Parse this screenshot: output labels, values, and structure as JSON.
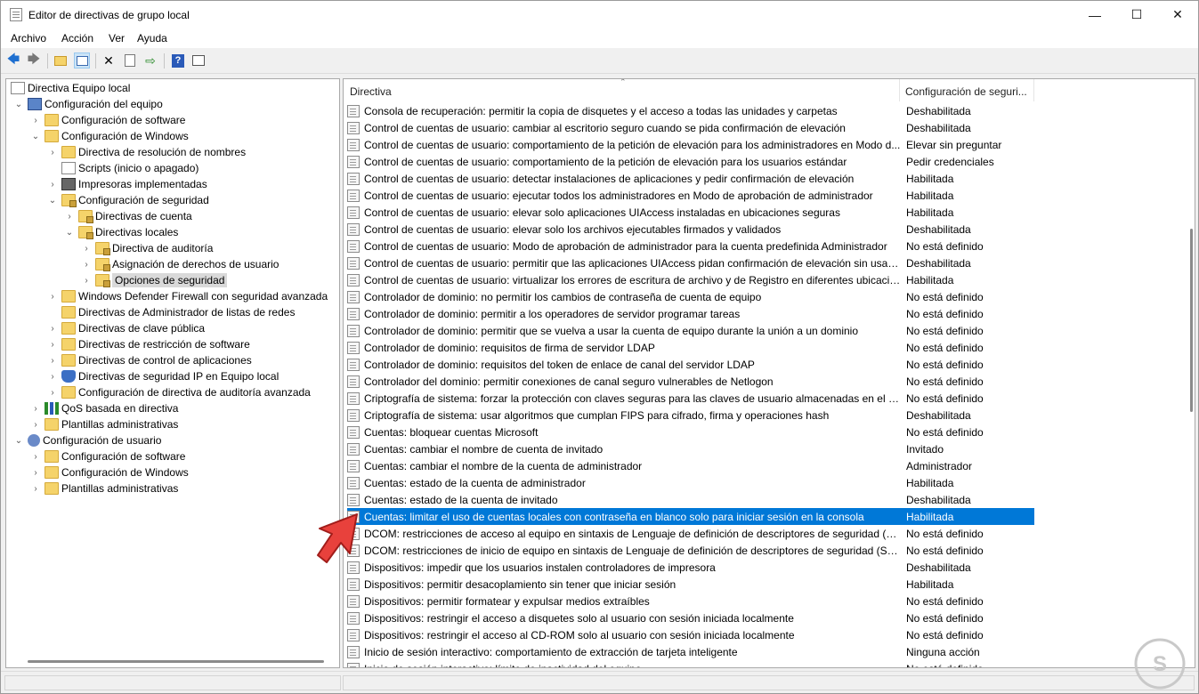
{
  "window": {
    "title": "Editor de directivas de grupo local",
    "controls": {
      "minimize": "—",
      "maximize": "☐",
      "close": "✕"
    }
  },
  "menu": [
    "Archivo",
    "Acción",
    "Ver",
    "Ayuda"
  ],
  "tree": [
    {
      "label": "Directiva Equipo local",
      "icon": "policy-doc-icon",
      "chev": ""
    },
    {
      "label": "Configuración del equipo",
      "icon": "computer-icon",
      "chev": "⌄"
    },
    {
      "label": "Configuración de software",
      "icon": "folder-icon",
      "chev": "›"
    },
    {
      "label": "Configuración de Windows",
      "icon": "folder-icon",
      "chev": "⌄"
    },
    {
      "label": "Directiva de resolución de nombres",
      "icon": "folder-icon",
      "chev": "›"
    },
    {
      "label": "Scripts (inicio o apagado)",
      "icon": "script-icon",
      "chev": ""
    },
    {
      "label": "Impresoras implementadas",
      "icon": "printer-icon",
      "chev": "›"
    },
    {
      "label": "Configuración de seguridad",
      "icon": "security-icon",
      "chev": "⌄"
    },
    {
      "label": "Directivas de cuenta",
      "icon": "folder-lock-icon",
      "chev": "›"
    },
    {
      "label": "Directivas locales",
      "icon": "folder-lock-icon",
      "chev": "⌄"
    },
    {
      "label": "Directiva de auditoría",
      "icon": "folder-lock-icon",
      "chev": "›"
    },
    {
      "label": "Asignación de derechos de usuario",
      "icon": "folder-lock-icon",
      "chev": "›"
    },
    {
      "label": "Opciones de seguridad",
      "icon": "folder-lock-icon",
      "chev": "›",
      "selected": true
    },
    {
      "label": "Windows Defender Firewall con seguridad avanzada",
      "icon": "folder-icon",
      "chev": "›"
    },
    {
      "label": "Directivas de Administrador de listas de redes",
      "icon": "folder-icon",
      "chev": ""
    },
    {
      "label": "Directivas de clave pública",
      "icon": "folder-icon",
      "chev": "›"
    },
    {
      "label": "Directivas de restricción de software",
      "icon": "folder-icon",
      "chev": "›"
    },
    {
      "label": "Directivas de control de aplicaciones",
      "icon": "folder-icon",
      "chev": "›"
    },
    {
      "label": "Directivas de seguridad IP en Equipo local",
      "icon": "ip-security-icon",
      "chev": "›"
    },
    {
      "label": "Configuración de directiva de auditoría avanzada",
      "icon": "folder-icon",
      "chev": "›"
    },
    {
      "label": "QoS basada en directiva",
      "icon": "qos-chart-icon",
      "chev": "›"
    },
    {
      "label": "Plantillas administrativas",
      "icon": "folder-icon",
      "chev": "›"
    },
    {
      "label": "Configuración de usuario",
      "icon": "user-icon",
      "chev": "⌄"
    },
    {
      "label": "Configuración de software",
      "icon": "folder-icon",
      "chev": "›"
    },
    {
      "label": "Configuración de Windows",
      "icon": "folder-icon",
      "chev": "›"
    },
    {
      "label": "Plantillas administrativas",
      "icon": "folder-icon",
      "chev": "›"
    }
  ],
  "columns": {
    "name": "Directiva",
    "value": "Configuración de seguri..."
  },
  "policies": [
    {
      "name": "Consola de recuperación: permitir la copia de disquetes y el acceso a todas las unidades y carpetas",
      "value": "Deshabilitada"
    },
    {
      "name": "Control de cuentas de usuario: cambiar al escritorio seguro cuando se pida confirmación de elevación",
      "value": "Deshabilitada"
    },
    {
      "name": "Control de cuentas de usuario: comportamiento de la petición de elevación para los administradores en Modo d...",
      "value": "Elevar sin preguntar"
    },
    {
      "name": "Control de cuentas de usuario: comportamiento de la petición de elevación para los usuarios estándar",
      "value": "Pedir credenciales"
    },
    {
      "name": "Control de cuentas de usuario: detectar instalaciones de aplicaciones y pedir confirmación de elevación",
      "value": "Habilitada"
    },
    {
      "name": "Control de cuentas de usuario: ejecutar todos los administradores en Modo de aprobación de administrador",
      "value": "Habilitada"
    },
    {
      "name": "Control de cuentas de usuario: elevar solo aplicaciones UIAccess instaladas en ubicaciones seguras",
      "value": "Habilitada"
    },
    {
      "name": "Control de cuentas de usuario: elevar solo los archivos ejecutables firmados y validados",
      "value": "Deshabilitada"
    },
    {
      "name": "Control de cuentas de usuario: Modo de aprobación de administrador para la cuenta predefinida Administrador",
      "value": "No está definido"
    },
    {
      "name": "Control de cuentas de usuario: permitir que las aplicaciones UIAccess pidan confirmación de elevación sin usar ...",
      "value": "Deshabilitada"
    },
    {
      "name": "Control de cuentas de usuario: virtualizar los errores de escritura de archivo y de Registro en diferentes ubicacion...",
      "value": "Habilitada"
    },
    {
      "name": "Controlador de dominio: no permitir los cambios de contraseña de cuenta de equipo",
      "value": "No está definido"
    },
    {
      "name": "Controlador de dominio: permitir a los operadores de servidor programar tareas",
      "value": "No está definido"
    },
    {
      "name": "Controlador de dominio: permitir que se vuelva a usar la cuenta de equipo durante la unión a un dominio",
      "value": "No está definido"
    },
    {
      "name": "Controlador de dominio: requisitos de firma de servidor LDAP",
      "value": "No está definido"
    },
    {
      "name": "Controlador de dominio: requisitos del token de enlace de canal del servidor LDAP",
      "value": "No está definido"
    },
    {
      "name": "Controlador del dominio: permitir conexiones de canal seguro vulnerables de Netlogon",
      "value": "No está definido"
    },
    {
      "name": "Criptografía de sistema: forzar la protección con claves seguras para las claves de usuario almacenadas en el equ...",
      "value": "No está definido"
    },
    {
      "name": "Criptografía de sistema: usar algoritmos que cumplan FIPS para cifrado, firma y operaciones hash",
      "value": "Deshabilitada"
    },
    {
      "name": "Cuentas: bloquear cuentas Microsoft",
      "value": "No está definido"
    },
    {
      "name": "Cuentas: cambiar el nombre de cuenta de invitado",
      "value": "Invitado"
    },
    {
      "name": "Cuentas: cambiar el nombre de la cuenta de administrador",
      "value": "Administrador"
    },
    {
      "name": "Cuentas: estado de la cuenta de administrador",
      "value": "Habilitada"
    },
    {
      "name": "Cuentas: estado de la cuenta de invitado",
      "value": "Deshabilitada"
    },
    {
      "name": "Cuentas: limitar el uso de cuentas locales con contraseña en blanco solo para iniciar sesión en la consola",
      "value": "Habilitada",
      "selected": true
    },
    {
      "name": "DCOM: restricciones de acceso al equipo en sintaxis de Lenguaje de definición de descriptores de seguridad (SD...",
      "value": "No está definido"
    },
    {
      "name": "DCOM: restricciones de inicio de equipo en sintaxis de Lenguaje de definición de descriptores de seguridad (SD...",
      "value": "No está definido"
    },
    {
      "name": "Dispositivos: impedir que los usuarios instalen controladores de impresora",
      "value": "Deshabilitada"
    },
    {
      "name": "Dispositivos: permitir desacoplamiento sin tener que iniciar sesión",
      "value": "Habilitada"
    },
    {
      "name": "Dispositivos: permitir formatear y expulsar medios extraíbles",
      "value": "No está definido"
    },
    {
      "name": "Dispositivos: restringir el acceso a disquetes solo al usuario con sesión iniciada localmente",
      "value": "No está definido"
    },
    {
      "name": "Dispositivos: restringir el acceso al CD-ROM solo al usuario con sesión iniciada localmente",
      "value": "No está definido"
    },
    {
      "name": "Inicio de sesión interactivo: comportamiento de extracción de tarjeta inteligente",
      "value": "Ninguna acción"
    },
    {
      "name": "Inicio de sesión interactivo: límite de inactividad del equipo",
      "value": "No está definido"
    }
  ],
  "colors": {
    "selection": "#0078d7",
    "tree_selection": "#d9d9d9",
    "arrow": "#e8413c"
  }
}
